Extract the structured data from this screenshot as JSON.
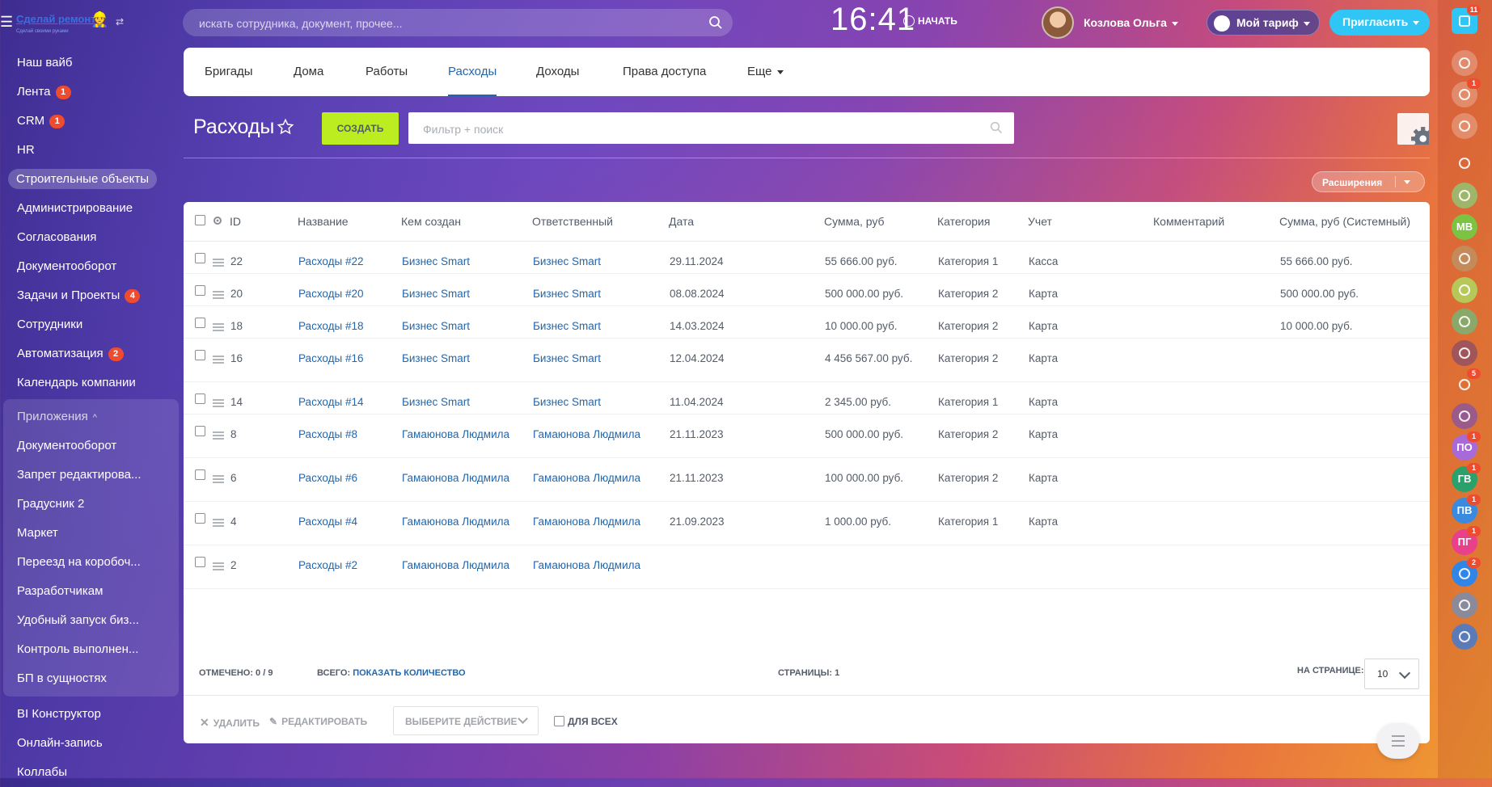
{
  "brand": {
    "logo_text": "Сделай ремонт",
    "logo_sub": "Сделай своими руками"
  },
  "search": {
    "placeholder": "искать сотрудника, документ, прочее..."
  },
  "header": {
    "clock": "16:41",
    "start_label": "НАЧАТЬ",
    "user_name": "Козлова Ольга",
    "tariff_label": "Мой тариф",
    "invite_label": "Пригласить"
  },
  "sidebar": {
    "items": [
      {
        "label": "Наш вайб",
        "badge": ""
      },
      {
        "label": "Лента",
        "badge": "1"
      },
      {
        "label": "CRM",
        "badge": "1"
      },
      {
        "label": "HR",
        "badge": ""
      },
      {
        "label": "Строительные объекты",
        "badge": ""
      },
      {
        "label": "Администрирование",
        "badge": ""
      },
      {
        "label": "Согласования",
        "badge": ""
      },
      {
        "label": "Документооборот",
        "badge": ""
      },
      {
        "label": "Задачи и Проекты",
        "badge": "4"
      },
      {
        "label": "Сотрудники",
        "badge": ""
      },
      {
        "label": "Автоматизация",
        "badge": "2"
      },
      {
        "label": "Календарь компании",
        "badge": ""
      }
    ],
    "apps_header": "Приложения",
    "apps": [
      "Документооборот",
      "Запрет редактирова...",
      "Градусник 2",
      "Маркет",
      "Переезд на коробоч...",
      "Разработчикам",
      "Удобный запуск биз...",
      "Контроль выполнен...",
      "БП в сущностях"
    ],
    "after_apps": [
      "BI Конструктор",
      "Онлайн-запись",
      "Коллабы"
    ]
  },
  "tabs": [
    "Бригады",
    "Дома",
    "Работы",
    "Расходы",
    "Доходы",
    "Права доступа",
    "Еще"
  ],
  "page": {
    "title": "Расходы",
    "create_label": "СОЗДАТЬ",
    "filter_placeholder": "Фильтр + поиск",
    "extensions_label": "Расширения"
  },
  "grid": {
    "columns": [
      "ID",
      "Название",
      "Кем создан",
      "Ответственный",
      "Дата",
      "Сумма, руб",
      "Категория",
      "Учет",
      "Комментарий",
      "Сумма, руб (Системный)"
    ],
    "rows": [
      {
        "id": "22",
        "name": "Расходы #22",
        "created_by": "Бизнес Smart",
        "responsible": "Бизнес Smart",
        "date": "29.11.2024",
        "sum": "55 666.00 руб.",
        "category": "Категория 1",
        "account": "Касса",
        "comment": "",
        "sum_system": "55 666.00 руб."
      },
      {
        "id": "20",
        "name": "Расходы #20",
        "created_by": "Бизнес Smart",
        "responsible": "Бизнес Smart",
        "date": "08.08.2024",
        "sum": "500 000.00 руб.",
        "category": "Категория 2",
        "account": "Карта",
        "comment": "",
        "sum_system": "500 000.00 руб."
      },
      {
        "id": "18",
        "name": "Расходы #18",
        "created_by": "Бизнес Smart",
        "responsible": "Бизнес Smart",
        "date": "14.03.2024",
        "sum": "10 000.00 руб.",
        "category": "Категория 2",
        "account": "Карта",
        "comment": "",
        "sum_system": "10 000.00 руб."
      },
      {
        "id": "16",
        "name": "Расходы #16",
        "created_by": "Бизнес Smart",
        "responsible": "Бизнес Smart",
        "date": "12.04.2024",
        "sum": "4 456 567.00 руб.",
        "category": "Категория 2",
        "account": "Карта",
        "comment": "",
        "sum_system": ""
      },
      {
        "id": "14",
        "name": "Расходы #14",
        "created_by": "Бизнес Smart",
        "responsible": "Бизнес Smart",
        "date": "11.04.2024",
        "sum": "2 345.00 руб.",
        "category": "Категория 1",
        "account": "Карта",
        "comment": "",
        "sum_system": ""
      },
      {
        "id": "8",
        "name": "Расходы #8",
        "created_by": "Гамаюнова Людмила",
        "responsible": "Гамаюнова Людмила",
        "date": "21.11.2023",
        "sum": "500 000.00 руб.",
        "category": "Категория 2",
        "account": "Карта",
        "comment": "",
        "sum_system": ""
      },
      {
        "id": "6",
        "name": "Расходы #6",
        "created_by": "Гамаюнова Людмила",
        "responsible": "Гамаюнова Людмила",
        "date": "21.11.2023",
        "sum": "100 000.00 руб.",
        "category": "Категория 2",
        "account": "Карта",
        "comment": "",
        "sum_system": ""
      },
      {
        "id": "4",
        "name": "Расходы #4",
        "created_by": "Гамаюнова Людмила",
        "responsible": "Гамаюнова Людмила",
        "date": "21.09.2023",
        "sum": "1 000.00 руб.",
        "category": "Категория 1",
        "account": "Карта",
        "comment": "",
        "sum_system": ""
      },
      {
        "id": "2",
        "name": "Расходы #2",
        "created_by": "Гамаюнова Людмила",
        "responsible": "Гамаюнова Людмила",
        "date": "",
        "sum": "",
        "category": "",
        "account": "",
        "comment": "",
        "sum_system": ""
      }
    ],
    "footer": {
      "selected_label": "ОТМЕЧЕНО: 0 / 9",
      "total_label": "ВСЕГО:",
      "show_count_label": "ПОКАЗАТЬ КОЛИЧЕСТВО",
      "pages_label": "СТРАНИЦЫ: 1",
      "per_page_label": "НА СТРАНИЦЕ:",
      "per_page_value": "10"
    },
    "actions": {
      "delete_label": "УДАЛИТЬ",
      "edit_label": "РЕДАКТИРОВАТЬ",
      "select_action_label": "ВЫБЕРИТЕ ДЕЙСТВИЕ",
      "for_all_label": "ДЛЯ ВСЕХ"
    }
  },
  "rail": [
    {
      "icon": "help-icon",
      "badge": "11",
      "color": "#2fc6f6"
    },
    {
      "icon": "activity-icon",
      "badge": "",
      "color": "rgba(255,255,255,0.25)"
    },
    {
      "icon": "bell-icon",
      "badge": "1",
      "color": "rgba(255,255,255,0.25)"
    },
    {
      "icon": "chat-icon",
      "badge": "",
      "color": "rgba(255,255,255,0.25)"
    },
    {
      "icon": "search-icon",
      "badge": "",
      "color": "transparent"
    },
    {
      "icon": "contact-card-icon",
      "badge": "",
      "color": "#9fb56a"
    },
    {
      "initials": "МВ",
      "badge": "",
      "color": "#7cc342"
    },
    {
      "icon": "avatar-icon",
      "badge": "",
      "color": "#c48a5a"
    },
    {
      "icon": "chat-bubble-icon",
      "badge": "",
      "color": "#b7c85a"
    },
    {
      "icon": "contact-card-icon",
      "badge": "",
      "color": "#8aa86a"
    },
    {
      "icon": "avatar-icon",
      "badge": "",
      "color": "#a0555a"
    },
    {
      "icon": "worker-icon",
      "badge": "5",
      "color": "transparent"
    },
    {
      "icon": "avatar-icon",
      "badge": "",
      "color": "#9a5a8a"
    },
    {
      "initials": "ПО",
      "badge": "1",
      "color": "#a86ad8"
    },
    {
      "initials": "ГВ",
      "badge": "1",
      "color": "#2aa06a"
    },
    {
      "initials": "ПВ",
      "badge": "1",
      "color": "#3a8ae0"
    },
    {
      "initials": "ПГ",
      "badge": "1",
      "color": "#e8408a"
    },
    {
      "icon": "task-icon",
      "badge": "2",
      "color": "#2f86e8"
    },
    {
      "icon": "contact-card-icon",
      "badge": "",
      "color": "#8a8a9a"
    },
    {
      "icon": "city-icon",
      "badge": "",
      "color": "#5a7ab8"
    }
  ]
}
